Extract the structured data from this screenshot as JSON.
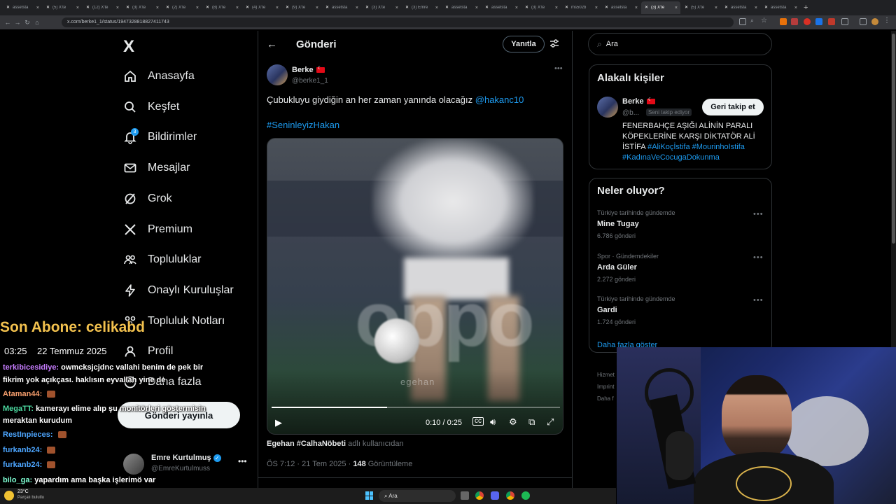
{
  "browser": {
    "tabs": [
      {
        "title": "assetsta",
        "active": false
      },
      {
        "title": "(5) X'te",
        "active": false
      },
      {
        "title": "(12) X'te",
        "active": false
      },
      {
        "title": "(3) X'te",
        "active": false
      },
      {
        "title": "(2) X'te",
        "active": false
      },
      {
        "title": "(8) X'te",
        "active": false
      },
      {
        "title": "(4) X'te",
        "active": false
      },
      {
        "title": "(9) X'te",
        "active": false
      },
      {
        "title": "assetsta",
        "active": false
      },
      {
        "title": "(3) X'te",
        "active": false
      },
      {
        "title": "(3) Emre",
        "active": false
      },
      {
        "title": "assetsta",
        "active": false
      },
      {
        "title": "assetsta",
        "active": false
      },
      {
        "title": "(3) X'te",
        "active": false
      },
      {
        "title": "ms502b",
        "active": false
      },
      {
        "title": "assetsta",
        "active": false
      },
      {
        "title": "(3) X'te",
        "active": true
      },
      {
        "title": "(5) X'te",
        "active": false
      },
      {
        "title": "assetsta",
        "active": false
      },
      {
        "title": "assetsta",
        "active": false
      }
    ],
    "url": "x.com/berke1_1/status/1947328818827411743"
  },
  "sidebar": {
    "logo": "X",
    "items": [
      {
        "label": "Anasayfa",
        "icon": "home-icon"
      },
      {
        "label": "Keşfet",
        "icon": "search-icon"
      },
      {
        "label": "Bildirimler",
        "icon": "bell-icon",
        "badge": "3"
      },
      {
        "label": "Mesajlar",
        "icon": "mail-icon"
      },
      {
        "label": "Grok",
        "icon": "grok-icon"
      },
      {
        "label": "Premium",
        "icon": "x-icon"
      },
      {
        "label": "Topluluklar",
        "icon": "communities-icon"
      },
      {
        "label": "Onaylı Kuruluşlar",
        "icon": "lightning-icon"
      },
      {
        "label": "Topluluk Notları",
        "icon": "notes-icon"
      },
      {
        "label": "Profil",
        "icon": "profile-icon"
      },
      {
        "label": "Daha fazla",
        "icon": "more-icon"
      }
    ],
    "post_button": "Gönderi yayınla",
    "account": {
      "name": "Emre Kurtulmuş",
      "handle": "@EmreKurtulmuss"
    }
  },
  "main": {
    "title": "Gönderi",
    "reply_button": "Yanıtla",
    "tweet": {
      "author": "Berke",
      "handle": "@berke1_1",
      "text": "Çubukluyu giydiğin an her zaman yanında olacağız",
      "mention": "@hakanc10",
      "hashtag": "#SeninleyizHakan",
      "video_watermark": "egehan",
      "video_time": "0:10 / 0:25",
      "video_progress": 0.4,
      "credit_user": "Egehan #CalhaNöbeti",
      "credit_suffix": "adlı kullanıcıdan",
      "timestamp": "ÖS 7:12 · 21 Tem 2025 ·",
      "views": "148",
      "views_label": "Görüntüleme"
    }
  },
  "right": {
    "search_placeholder": "Ara",
    "people": {
      "title": "Alakalı kişiler",
      "name": "Berke",
      "handle": "@b...",
      "follows_you": "Seni takip ediyor",
      "follow_back": "Geri takip et",
      "bio": "FENERBAHÇE AŞIĞI ALİNİN PARALI KÖPEKLERİNE KARŞI DİKTATÖR ALİ İSTİFA",
      "bio_tags": "#AliKoçİstifa #MourinhoIstifa #KadınaVeCocugaDokunma"
    },
    "trends": {
      "title": "Neler oluyor?",
      "items": [
        {
          "category": "Türkiye tarihinde gündemde",
          "name": "Mine Tugay",
          "count": "6.786 gönderi"
        },
        {
          "category": "Spor · Gündemdekiler",
          "name": "Arda Güler",
          "count": "2.272 gönderi"
        },
        {
          "category": "Türkiye tarihinde gündemde",
          "name": "Gardi",
          "count": "1.724 gönderi"
        }
      ],
      "show_more": "Daha fazla göster"
    },
    "footer": [
      "Hizmet",
      "Imprint",
      "Daha f"
    ]
  },
  "overlay": {
    "last_sub": "Son Abone: celikabd",
    "time": "03:25",
    "date": "22 Temmuz 2025",
    "chat": [
      {
        "user": "terkibicesidiye:",
        "message": "owmcksjcjdnc vallahi benim de pek bir",
        "color": "#c77dff"
      },
      {
        "user": "",
        "message": "fikrim yok açıkçası. haklısın eyvallah yine de",
        "color": "#ffffff"
      },
      {
        "user": "Ataman44:",
        "message": "",
        "color": "#f39c6b"
      },
      {
        "user": "MegaTT:",
        "message": "kamerayı elime alıp şu monitörleri göstermisin",
        "color": "#4cd9a0"
      },
      {
        "user": "",
        "message": "meraktan kurudum",
        "color": "#ffffff"
      },
      {
        "user": "RestInpieces:",
        "message": "",
        "color": "#4da6ff"
      },
      {
        "user": "furkanb24:",
        "message": "",
        "color": "#4da6ff"
      },
      {
        "user": "furkanb24:",
        "message": "",
        "color": "#4da6ff"
      },
      {
        "user": "bilo_ga:",
        "message": "yapardım ama başka işlerimö var",
        "color": "#7fffd4"
      }
    ]
  },
  "taskbar": {
    "weather": "23°C",
    "weather_sub": "Parçalı bulutlu",
    "search": "Ara"
  }
}
